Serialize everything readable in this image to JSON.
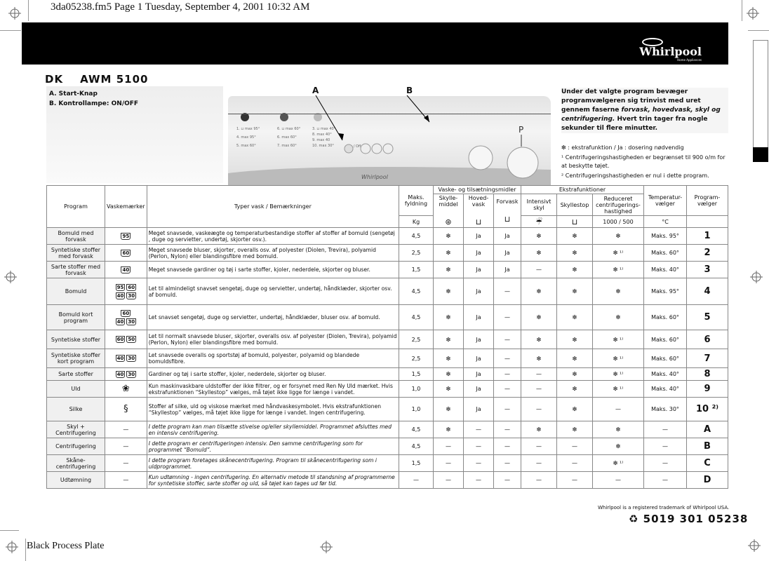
{
  "print_header": "3da05238.fm5  Page 1  Tuesday, September 4, 2001  10:32 AM",
  "brand": {
    "name": "Whirlpool",
    "tagline": "Home Appliances"
  },
  "model": {
    "country": "DK",
    "name": "AWM 5100"
  },
  "legend": {
    "a": "A. Start-Knap",
    "b": "B. Kontrollampe: ON/OFF"
  },
  "callouts": {
    "a": "A",
    "b": "B"
  },
  "description": {
    "part1": "Under det valgte program bevæger programvælgeren sig trinvist med uret gennem faserne ",
    "italic": "forvask, hovedvask, skyl og centrifugering.",
    "part2": " Hvert trin tager fra nogle sekunder til flere minutter."
  },
  "notes": {
    "star_note": "❇ : ekstrafunktion / Ja : dosering nødvendig",
    "n1": "¹  Centrifugeringshastigheden er begrænset til 900 o/m for at beskytte tøjet.",
    "n2": "²  Centrifugeringshastigheden er nul i dette program."
  },
  "table": {
    "headers": {
      "program": "Program",
      "care": "Vaskemærker",
      "types": "Typer vask / Bemærkninger",
      "load": "Maks. fyldning",
      "load_unit": "Kg",
      "detergent_group": "Vaske- og tilsætningsmidler",
      "softener": "Skylle-middel",
      "main_wash": "Hoved-vask",
      "prewash": "Forvask",
      "extra_group": "Ekstrafunktioner",
      "intensive_rinse": "Intensivt skyl",
      "rinse_hold": "Skyllestop",
      "reduced_spin": "Reduceret centrifugerings-hastighed",
      "spin_values": "1000 / 500",
      "temp": "Temperatur-vælger",
      "temp_unit": "°C",
      "selector": "Program-vælger"
    },
    "rows": [
      {
        "name": "Bomuld med forvask",
        "care": [
          "95"
        ],
        "desc": "Meget snavsede, vaskeægte og temperaturbestandige stoffer af stoffer af bomuld (sengetøj , duge og servietter, undertøj, skjorter osv.).",
        "italic": false,
        "load": "4,5",
        "softener": "❇",
        "main": "Ja",
        "pre": "Ja",
        "intensive": "❇",
        "hold": "❇",
        "spin": "❇",
        "temp": "Maks. 95°",
        "num": "1"
      },
      {
        "name": "Syntetiske stoffer med forvask",
        "care": [
          "60"
        ],
        "desc": "Meget snavsede bluser, skjorter, overalls osv. af polyester (Diolen, Trevira), polyamid (Perlon, Nylon) eller blandingsfibre med bomuld.",
        "italic": false,
        "load": "2,5",
        "softener": "❇",
        "main": "Ja",
        "pre": "Ja",
        "intensive": "❇",
        "hold": "❇",
        "spin": "❇ ¹⁾",
        "temp": "Maks. 60°",
        "num": "2"
      },
      {
        "name": "Sarte stoffer med forvask",
        "care": [
          "40"
        ],
        "desc": "Meget snavsede gardiner og tøj i sarte stoffer, kjoler, nederdele, skjorter og bluser.",
        "italic": false,
        "load": "1,5",
        "softener": "❇",
        "main": "Ja",
        "pre": "Ja",
        "intensive": "—",
        "hold": "❇",
        "spin": "❇ ¹⁾",
        "temp": "Maks. 40°",
        "num": "3"
      },
      {
        "name": "Bomuld",
        "care": [
          "95",
          "60",
          "40",
          "30"
        ],
        "desc": "Let til almindeligt snavset sengetøj, duge og servietter, undertøj, håndklæder, skjorter osv. af bomuld.",
        "italic": false,
        "load": "4,5",
        "softener": "❇",
        "main": "Ja",
        "pre": "—",
        "intensive": "❇",
        "hold": "❇",
        "spin": "❇",
        "temp": "Maks. 95°",
        "num": "4"
      },
      {
        "name": "Bomuld kort program",
        "care": [
          "60",
          "40",
          "30"
        ],
        "desc": "Let snavset sengetøj, duge og servietter, undertøj, håndklæder, bluser osv. af bomuld.",
        "italic": false,
        "load": "4,5",
        "softener": "❇",
        "main": "Ja",
        "pre": "—",
        "intensive": "❇",
        "hold": "❇",
        "spin": "❇",
        "temp": "Maks. 60°",
        "num": "5"
      },
      {
        "name": "Syntetiske stoffer",
        "care": [
          "60",
          "50"
        ],
        "desc": "Let til normalt snavsede bluser, skjorter, overalls osv. af polyester (Diolen, Trevira), polyamid (Perlon, Nylon) eller blandingsfibre med bomuld.",
        "italic": false,
        "load": "2,5",
        "softener": "❇",
        "main": "Ja",
        "pre": "—",
        "intensive": "❇",
        "hold": "❇",
        "spin": "❇ ¹⁾",
        "temp": "Maks. 60°",
        "num": "6"
      },
      {
        "name": "Syntetiske stoffer kort program",
        "care": [
          "40",
          "30"
        ],
        "desc": "Let snavsede overalls og sportstøj af bomuld, polyester, polyamid og blandede bomuldsfibre.",
        "italic": false,
        "load": "2,5",
        "softener": "❇",
        "main": "Ja",
        "pre": "—",
        "intensive": "❇",
        "hold": "❇",
        "spin": "❇ ¹⁾",
        "temp": "Maks. 60°",
        "num": "7"
      },
      {
        "name": "Sarte stoffer",
        "care": [
          "40",
          "30"
        ],
        "desc": "Gardiner og tøj i sarte stoffer, kjoler, nederdele, skjorter og bluser.",
        "italic": false,
        "load": "1,5",
        "softener": "❇",
        "main": "Ja",
        "pre": "—",
        "intensive": "—",
        "hold": "❇",
        "spin": "❇ ¹⁾",
        "temp": "Maks. 40°",
        "num": "8"
      },
      {
        "name": "Uld",
        "care": [
          "wool-icon"
        ],
        "desc": "Kun maskinvaskbare uldstoffer der ikke filtrer, og er forsynet med Ren Ny Uld mærket. Hvis ekstrafunktionen “Skyllestop” vælges, må tøjet ikke ligge for længe i vandet.",
        "italic": false,
        "load": "1,0",
        "softener": "❇",
        "main": "Ja",
        "pre": "—",
        "intensive": "—",
        "hold": "❇",
        "spin": "❇ ¹⁾",
        "temp": "Maks. 40°",
        "num": "9"
      },
      {
        "name": "Silke",
        "care": [
          "silk-icon"
        ],
        "desc": "Stoffer af silke, uld og viskose mærket med håndvaskesymbolet. Hvis ekstrafunktionen “Skyllestop” vælges, må tøjet ikke ligge for længe i vandet. Ingen centrifugering.",
        "italic": false,
        "load": "1,0",
        "softener": "❇",
        "main": "Ja",
        "pre": "—",
        "intensive": "—",
        "hold": "❇",
        "spin": "—",
        "temp": "Maks. 30°",
        "num": "10 ²⁾"
      },
      {
        "name": "Skyl + Centrifugering",
        "care": [
          "—"
        ],
        "desc": "I dette program kan man tilsætte stivelse og/eller skyllemiddel. Programmet afsluttes med en intensiv centrifugering.",
        "italic": true,
        "load": "4,5",
        "softener": "❇",
        "main": "—",
        "pre": "—",
        "intensive": "❇",
        "hold": "❇",
        "spin": "❇",
        "temp": "—",
        "num": "A"
      },
      {
        "name": "Centrifugering",
        "care": [
          "—"
        ],
        "desc": "I dette program er centrifugeringen intensiv. Den samme centrifugering som for programmet “Bomuld”.",
        "italic": true,
        "load": "4,5",
        "softener": "—",
        "main": "—",
        "pre": "—",
        "intensive": "—",
        "hold": "—",
        "spin": "❇",
        "temp": "—",
        "num": "B"
      },
      {
        "name": "Skåne-centrifugering",
        "care": [
          "—"
        ],
        "desc": "I dette program foretages skånecentrifugering. Program til skånecentrifugering som i uldprogrammet.",
        "italic": true,
        "load": "1,5",
        "softener": "—",
        "main": "—",
        "pre": "—",
        "intensive": "—",
        "hold": "—",
        "spin": "❇ ¹⁾",
        "temp": "—",
        "num": "C"
      },
      {
        "name": "Udtømning",
        "care": [
          "—"
        ],
        "desc": "Kun udtømning - ingen centrifugering. En alternativ metode til standsning af programmerne for syntetiske stoffer, sarte stoffer og uld, så tøjet kan tages ud før tid.",
        "italic": true,
        "load": "—",
        "softener": "—",
        "main": "—",
        "pre": "—",
        "intensive": "—",
        "hold": "—",
        "spin": "—",
        "temp": "—",
        "num": "D"
      }
    ]
  },
  "footer": {
    "trademark": "Whirlpool is a registered trademark of Whirlpool USA.",
    "code": "5019 301 05238",
    "plate": "Black Process Plate"
  }
}
